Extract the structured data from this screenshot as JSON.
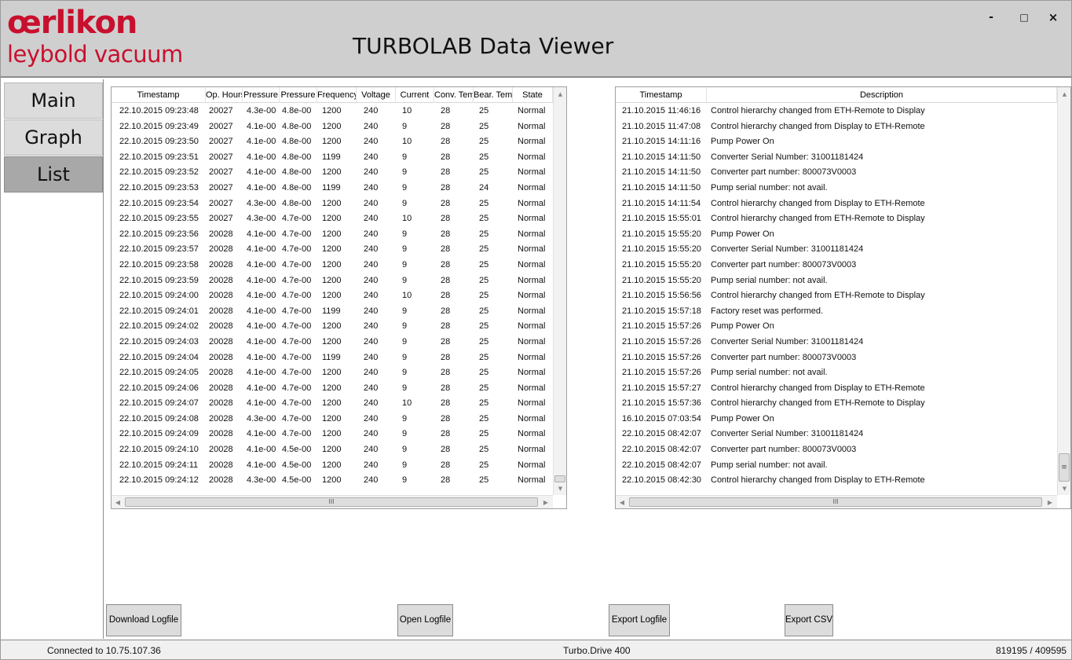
{
  "header": {
    "logo_top": "œrlikon",
    "logo_bottom": "leybold vacuum",
    "title": "TURBOLAB Data Viewer",
    "window_controls": {
      "minimize": "-",
      "maximize": "□",
      "close": "×"
    }
  },
  "nav": {
    "items": [
      {
        "label": "Main",
        "active": false
      },
      {
        "label": "Graph",
        "active": false
      },
      {
        "label": "List",
        "active": true
      }
    ]
  },
  "data_table": {
    "columns": [
      "Timestamp",
      "Op. Hours",
      "Pressure",
      "Pressure",
      "Frequency",
      "Voltage",
      "Current",
      "Conv. Temp",
      "Bear. Temp",
      "State"
    ],
    "rows": [
      [
        "22.10.2015 09:23:48",
        "20027",
        "4.3e-00",
        "4.8e-00",
        "1200",
        "240",
        "10",
        "28",
        "25",
        "Normal"
      ],
      [
        "22.10.2015 09:23:49",
        "20027",
        "4.1e-00",
        "4.8e-00",
        "1200",
        "240",
        "9",
        "28",
        "25",
        "Normal"
      ],
      [
        "22.10.2015 09:23:50",
        "20027",
        "4.1e-00",
        "4.8e-00",
        "1200",
        "240",
        "10",
        "28",
        "25",
        "Normal"
      ],
      [
        "22.10.2015 09:23:51",
        "20027",
        "4.1e-00",
        "4.8e-00",
        "1199",
        "240",
        "9",
        "28",
        "25",
        "Normal"
      ],
      [
        "22.10.2015 09:23:52",
        "20027",
        "4.1e-00",
        "4.8e-00",
        "1200",
        "240",
        "9",
        "28",
        "25",
        "Normal"
      ],
      [
        "22.10.2015 09:23:53",
        "20027",
        "4.1e-00",
        "4.8e-00",
        "1199",
        "240",
        "9",
        "28",
        "24",
        "Normal"
      ],
      [
        "22.10.2015 09:23:54",
        "20027",
        "4.3e-00",
        "4.8e-00",
        "1200",
        "240",
        "9",
        "28",
        "25",
        "Normal"
      ],
      [
        "22.10.2015 09:23:55",
        "20027",
        "4.3e-00",
        "4.7e-00",
        "1200",
        "240",
        "10",
        "28",
        "25",
        "Normal"
      ],
      [
        "22.10.2015 09:23:56",
        "20028",
        "4.1e-00",
        "4.7e-00",
        "1200",
        "240",
        "9",
        "28",
        "25",
        "Normal"
      ],
      [
        "22.10.2015 09:23:57",
        "20028",
        "4.1e-00",
        "4.7e-00",
        "1200",
        "240",
        "9",
        "28",
        "25",
        "Normal"
      ],
      [
        "22.10.2015 09:23:58",
        "20028",
        "4.1e-00",
        "4.7e-00",
        "1200",
        "240",
        "9",
        "28",
        "25",
        "Normal"
      ],
      [
        "22.10.2015 09:23:59",
        "20028",
        "4.1e-00",
        "4.7e-00",
        "1200",
        "240",
        "9",
        "28",
        "25",
        "Normal"
      ],
      [
        "22.10.2015 09:24:00",
        "20028",
        "4.1e-00",
        "4.7e-00",
        "1200",
        "240",
        "10",
        "28",
        "25",
        "Normal"
      ],
      [
        "22.10.2015 09:24:01",
        "20028",
        "4.1e-00",
        "4.7e-00",
        "1199",
        "240",
        "9",
        "28",
        "25",
        "Normal"
      ],
      [
        "22.10.2015 09:24:02",
        "20028",
        "4.1e-00",
        "4.7e-00",
        "1200",
        "240",
        "9",
        "28",
        "25",
        "Normal"
      ],
      [
        "22.10.2015 09:24:03",
        "20028",
        "4.1e-00",
        "4.7e-00",
        "1200",
        "240",
        "9",
        "28",
        "25",
        "Normal"
      ],
      [
        "22.10.2015 09:24:04",
        "20028",
        "4.1e-00",
        "4.7e-00",
        "1199",
        "240",
        "9",
        "28",
        "25",
        "Normal"
      ],
      [
        "22.10.2015 09:24:05",
        "20028",
        "4.1e-00",
        "4.7e-00",
        "1200",
        "240",
        "9",
        "28",
        "25",
        "Normal"
      ],
      [
        "22.10.2015 09:24:06",
        "20028",
        "4.1e-00",
        "4.7e-00",
        "1200",
        "240",
        "9",
        "28",
        "25",
        "Normal"
      ],
      [
        "22.10.2015 09:24:07",
        "20028",
        "4.1e-00",
        "4.7e-00",
        "1200",
        "240",
        "10",
        "28",
        "25",
        "Normal"
      ],
      [
        "22.10.2015 09:24:08",
        "20028",
        "4.3e-00",
        "4.7e-00",
        "1200",
        "240",
        "9",
        "28",
        "25",
        "Normal"
      ],
      [
        "22.10.2015 09:24:09",
        "20028",
        "4.1e-00",
        "4.7e-00",
        "1200",
        "240",
        "9",
        "28",
        "25",
        "Normal"
      ],
      [
        "22.10.2015 09:24:10",
        "20028",
        "4.1e-00",
        "4.5e-00",
        "1200",
        "240",
        "9",
        "28",
        "25",
        "Normal"
      ],
      [
        "22.10.2015 09:24:11",
        "20028",
        "4.1e-00",
        "4.5e-00",
        "1200",
        "240",
        "9",
        "28",
        "25",
        "Normal"
      ],
      [
        "22.10.2015 09:24:12",
        "20028",
        "4.3e-00",
        "4.5e-00",
        "1200",
        "240",
        "9",
        "28",
        "25",
        "Normal"
      ]
    ],
    "hscroll_grip": "III"
  },
  "event_table": {
    "columns": [
      "Timestamp",
      "Description"
    ],
    "rows": [
      [
        "21.10.2015 11:46:16",
        "Control hierarchy changed from ETH-Remote to Display"
      ],
      [
        "21.10.2015 11:47:08",
        "Control hierarchy changed from Display to ETH-Remote"
      ],
      [
        "21.10.2015 14:11:16",
        "Pump Power On"
      ],
      [
        "21.10.2015 14:11:50",
        "Converter Serial Number: 31001181424"
      ],
      [
        "21.10.2015 14:11:50",
        "Converter part number: 800073V0003"
      ],
      [
        "21.10.2015 14:11:50",
        "Pump serial number: not avail."
      ],
      [
        "21.10.2015 14:11:54",
        "Control hierarchy changed from Display to ETH-Remote"
      ],
      [
        "21.10.2015 15:55:01",
        "Control hierarchy changed from ETH-Remote to Display"
      ],
      [
        "21.10.2015 15:55:20",
        "Pump Power On"
      ],
      [
        "21.10.2015 15:55:20",
        "Converter Serial Number: 31001181424"
      ],
      [
        "21.10.2015 15:55:20",
        "Converter part number: 800073V0003"
      ],
      [
        "21.10.2015 15:55:20",
        "Pump serial number: not avail."
      ],
      [
        "21.10.2015 15:56:56",
        "Control hierarchy changed from ETH-Remote to Display"
      ],
      [
        "21.10.2015 15:57:18",
        "Factory reset was performed."
      ],
      [
        "21.10.2015 15:57:26",
        "Pump Power On"
      ],
      [
        "21.10.2015 15:57:26",
        "Converter Serial Number: 31001181424"
      ],
      [
        "21.10.2015 15:57:26",
        "Converter part number: 800073V0003"
      ],
      [
        "21.10.2015 15:57:26",
        "Pump serial number: not avail."
      ],
      [
        "21.10.2015 15:57:27",
        "Control hierarchy changed from Display to ETH-Remote"
      ],
      [
        "21.10.2015 15:57:36",
        "Control hierarchy changed from ETH-Remote to Display"
      ],
      [
        "16.10.2015 07:03:54",
        "Pump Power On"
      ],
      [
        "22.10.2015 08:42:07",
        "Converter Serial Number: 31001181424"
      ],
      [
        "22.10.2015 08:42:07",
        "Converter part number: 800073V0003"
      ],
      [
        "22.10.2015 08:42:07",
        "Pump serial number: not avail."
      ],
      [
        "22.10.2015 08:42:30",
        "Control hierarchy changed from Display to ETH-Remote"
      ]
    ],
    "hscroll_grip": "III",
    "vscroll_grip": "≡"
  },
  "buttons": {
    "download": "Download Logfile",
    "open": "Open Logfile",
    "export_logfile": "Export Logfile",
    "export_csv": "Export CSV"
  },
  "status": {
    "connection": "Connected to 10.75.107.36",
    "device": "Turbo.Drive 400",
    "counter": "819195 / 409595"
  },
  "colors": {
    "brand_red": "#c8102e",
    "header_bg": "#cfcfcf",
    "nav_active": "#a8a8a8",
    "button_bg": "#dcdcdc"
  }
}
